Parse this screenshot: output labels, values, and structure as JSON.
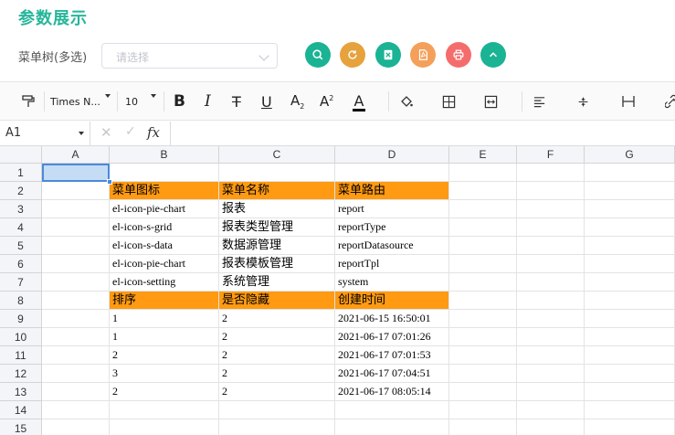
{
  "page": {
    "title": "参数展示"
  },
  "filter": {
    "label": "菜单树(多选)",
    "placeholder": "请选择"
  },
  "actions": [
    {
      "name": "search-button",
      "icon": "search-icon",
      "color": "#1ab394"
    },
    {
      "name": "reset-button",
      "icon": "refresh-icon",
      "color": "#e6a23c"
    },
    {
      "name": "export-excel-button",
      "icon": "excel-icon",
      "color": "#1ab394"
    },
    {
      "name": "export-pdf-button",
      "icon": "pdf-icon",
      "color": "#f4a05a"
    },
    {
      "name": "print-button",
      "icon": "print-icon",
      "color": "#f56c6c"
    },
    {
      "name": "collapse-button",
      "icon": "chevron-up-icon",
      "color": "#1ab394"
    }
  ],
  "toolbar": {
    "font_family": "Times N...",
    "font_size": "10"
  },
  "formula_bar": {
    "cell_ref": "A1",
    "fx": "fx"
  },
  "columns": [
    "A",
    "B",
    "C",
    "D",
    "E",
    "F",
    "G"
  ],
  "rows": [
    "1",
    "2",
    "3",
    "4",
    "5",
    "6",
    "7",
    "8",
    "9",
    "10",
    "11",
    "12",
    "13",
    "14",
    "15"
  ],
  "cells": {
    "r2": [
      "菜单图标",
      "菜单名称",
      "菜单路由"
    ],
    "r3": [
      "el-icon-pie-chart",
      "报表",
      "report"
    ],
    "r4": [
      "el-icon-s-grid",
      "报表类型管理",
      "reportType"
    ],
    "r5": [
      "el-icon-s-data",
      "数据源管理",
      "reportDatasource"
    ],
    "r6": [
      "el-icon-pie-chart",
      "报表模板管理",
      "reportTpl"
    ],
    "r7": [
      "el-icon-setting",
      "系统管理",
      "system"
    ],
    "r8": [
      "排序",
      "是否隐藏",
      "创建时间"
    ],
    "r9": [
      "1",
      "2",
      "2021-06-15 16:50:01"
    ],
    "r10": [
      "1",
      "2",
      "2021-06-17 07:01:26"
    ],
    "r11": [
      "2",
      "2",
      "2021-06-17 07:01:53"
    ],
    "r12": [
      "3",
      "2",
      "2021-06-17 07:04:51"
    ],
    "r13": [
      "2",
      "2",
      "2021-06-17 08:05:14"
    ]
  },
  "colors": {
    "accent": "#26b69a",
    "header_fill": "#ff9a12",
    "selection": "#4b89dc"
  }
}
